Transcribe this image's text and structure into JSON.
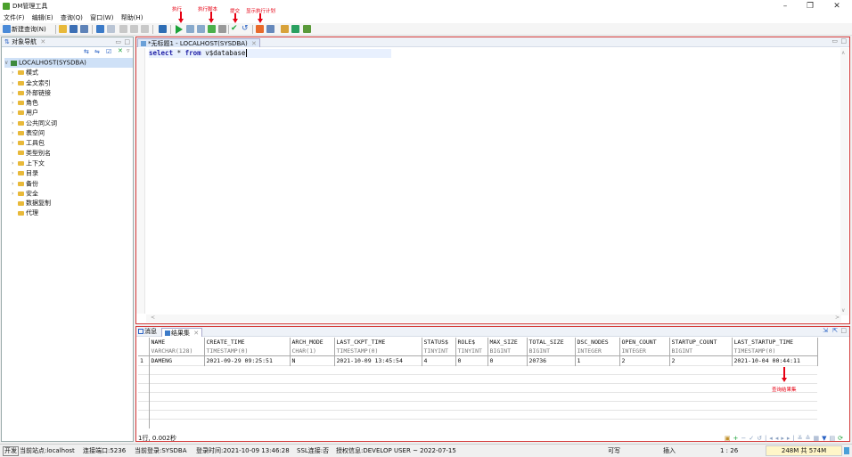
{
  "window": {
    "title": "DM管理工具"
  },
  "menu": [
    "文件(F)",
    "编辑(E)",
    "查询(Q)",
    "窗口(W)",
    "帮助(H)"
  ],
  "toolbar": {
    "new_query_label": "新建查询(N)"
  },
  "annotations": {
    "execute": "执行",
    "execute_script": "执行脚本",
    "commit": "提交",
    "show_plan": "显示执行计划",
    "result_note": "查询结果集"
  },
  "navigator": {
    "tab_label": "对象导航",
    "root": "LOCALHOST(SYSDBA)",
    "items": [
      {
        "label": "模式",
        "expandable": true
      },
      {
        "label": "全文索引",
        "expandable": true
      },
      {
        "label": "外部链接",
        "expandable": true
      },
      {
        "label": "角色",
        "expandable": true
      },
      {
        "label": "用户",
        "expandable": true
      },
      {
        "label": "公共同义词",
        "expandable": true
      },
      {
        "label": "表空间",
        "expandable": true
      },
      {
        "label": "工具包",
        "expandable": true
      },
      {
        "label": "类型别名",
        "expandable": false
      },
      {
        "label": "上下文",
        "expandable": true
      },
      {
        "label": "目录",
        "expandable": true
      },
      {
        "label": "备份",
        "expandable": true
      },
      {
        "label": "安全",
        "expandable": true
      },
      {
        "label": "数据复制",
        "expandable": false
      },
      {
        "label": "代理",
        "expandable": false
      }
    ]
  },
  "editor": {
    "tab_label": "*无标题1 - LOCALHOST(SYSDBA)",
    "sql_kw1": "select",
    "sql_mid": " * ",
    "sql_kw2": "from",
    "sql_rest": " v$database"
  },
  "results": {
    "tab_messages": "消息",
    "tab_resultset": "结果集",
    "columns": [
      {
        "name": "NAME",
        "type": "VARCHAR(128)"
      },
      {
        "name": "CREATE_TIME",
        "type": "TIMESTAMP(0)"
      },
      {
        "name": "ARCH_MODE",
        "type": "CHAR(1)"
      },
      {
        "name": "LAST_CKPT_TIME",
        "type": "TIMESTAMP(0)"
      },
      {
        "name": "STATUS$",
        "type": "TINYINT"
      },
      {
        "name": "ROLE$",
        "type": "TINYINT"
      },
      {
        "name": "MAX_SIZE",
        "type": "BIGINT"
      },
      {
        "name": "TOTAL_SIZE",
        "type": "BIGINT"
      },
      {
        "name": "DSC_NODES",
        "type": "INTEGER"
      },
      {
        "name": "OPEN_COUNT",
        "type": "INTEGER"
      },
      {
        "name": "STARTUP_COUNT",
        "type": "BIGINT"
      },
      {
        "name": "LAST_STARTUP_TIME",
        "type": "TIMESTAMP(0)"
      }
    ],
    "row_number": "1",
    "row": [
      "DAMENG",
      "2021-09-29 09:25:51",
      "N",
      "2021-10-09 13:45:54",
      "4",
      "0",
      "0",
      "20736",
      "1",
      "2",
      "2",
      "2021-10-04 00:44:11"
    ],
    "summary": "1行, 0.002秒"
  },
  "status": {
    "mode": "开发",
    "site": "当前站点:localhost",
    "port": "连接端口:5236",
    "login": "当前登录:SYSDBA",
    "login_time": "登录时间:2021-10-09 13:46:28",
    "ssl": "SSL连接:否",
    "license": "授权信息:DEVELOP USER ~ 2022-07-15",
    "writable": "可写",
    "insert": "插入",
    "position": "1 : 26",
    "memory": "248M 共 574M"
  }
}
